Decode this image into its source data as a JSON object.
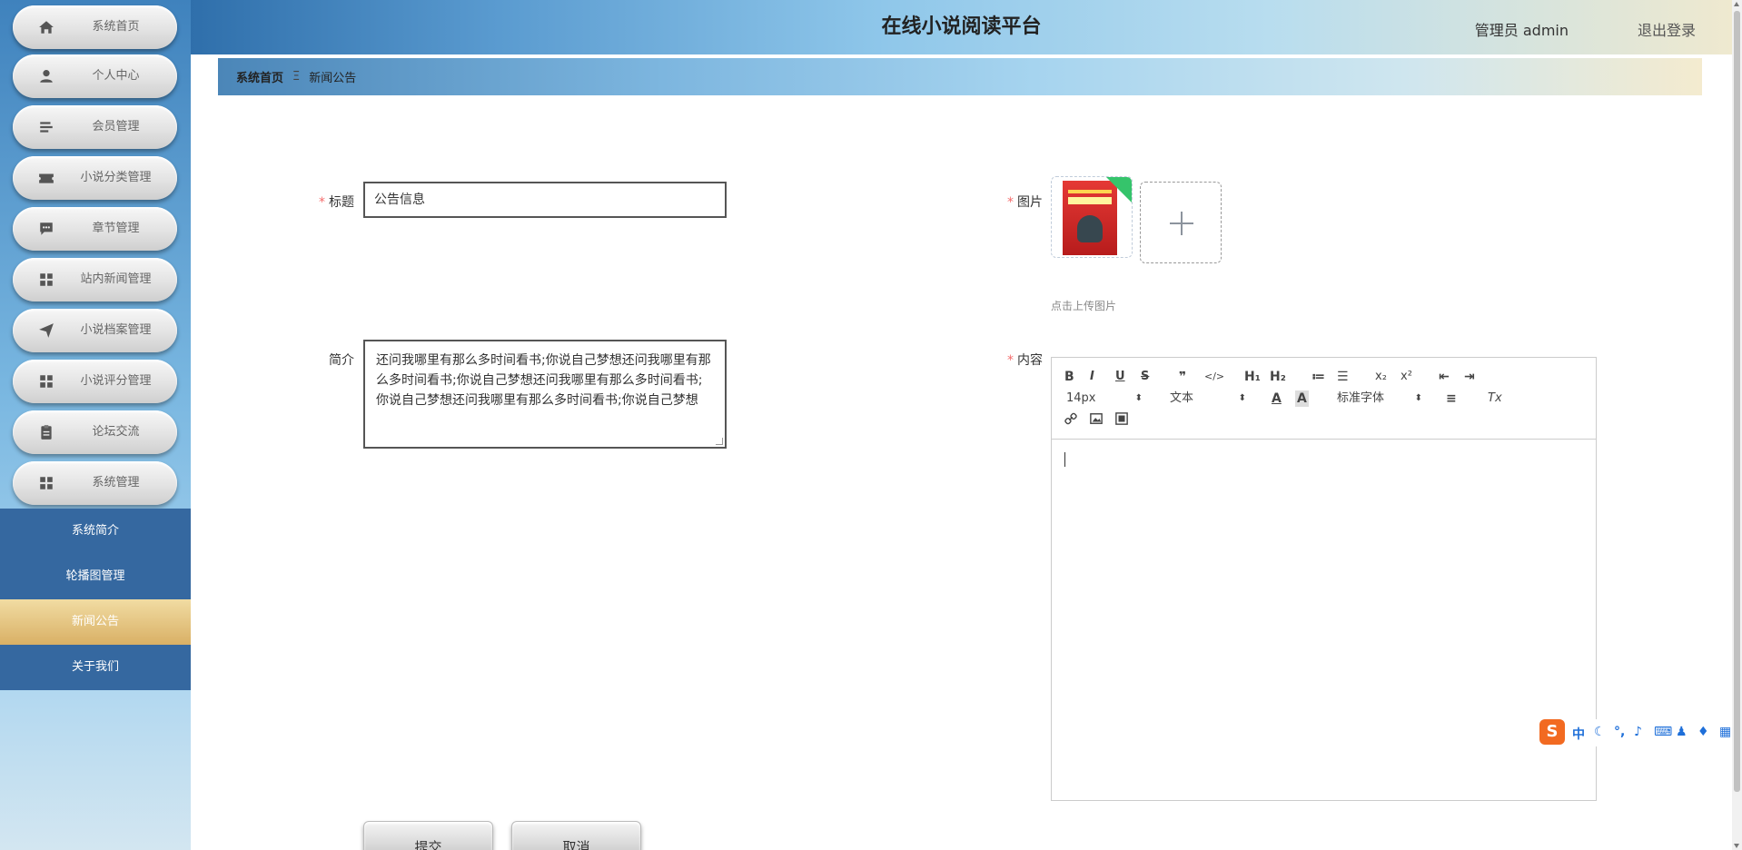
{
  "header": {
    "title": "在线小说阅读平台",
    "user": "管理员 admin",
    "logout": "退出登录"
  },
  "sidebar": {
    "items": [
      {
        "label": "系统首页",
        "icon": "home-icon"
      },
      {
        "label": "个人中心",
        "icon": "user-icon"
      },
      {
        "label": "会员管理",
        "icon": "list-icon"
      },
      {
        "label": "小说分类管理",
        "icon": "ticket-icon"
      },
      {
        "label": "章节管理",
        "icon": "chat-icon"
      },
      {
        "label": "站内新闻管理",
        "icon": "grid-icon"
      },
      {
        "label": "小说档案管理",
        "icon": "send-icon"
      },
      {
        "label": "小说评分管理",
        "icon": "grid-icon"
      },
      {
        "label": "论坛交流",
        "icon": "clipboard-icon"
      },
      {
        "label": "系统管理",
        "icon": "grid-icon"
      }
    ],
    "sub_items": [
      {
        "label": "系统简介"
      },
      {
        "label": "轮播图管理"
      },
      {
        "label": "新闻公告",
        "active": true
      },
      {
        "label": "关于我们"
      }
    ]
  },
  "breadcrumb": {
    "home": "系统首页",
    "separator": "Ξ",
    "current": "新闻公告"
  },
  "form": {
    "title_label": "标题",
    "title_value": "公告信息",
    "intro_label": "简介",
    "intro_value": "还问我哪里有那么多时间看书;你说自己梦想还问我哪里有那么多时间看书;你说自己梦想还问我哪里有那么多时间看书;你说自己梦想还问我哪里有那么多时间看书;你说自己梦想",
    "image_label": "图片",
    "image_hint": "点击上传图片",
    "content_label": "内容",
    "required_mark": "*"
  },
  "editor": {
    "font_size": "14px",
    "paragraph": "文本",
    "font_family": "标准字体",
    "buttons": {
      "bold": "B",
      "italic": "I",
      "underline": "U",
      "strike": "S",
      "quote": "❞",
      "code": "</>",
      "h1": "H₁",
      "h2": "H₂",
      "ol": "≔",
      "ul": "☰",
      "sub": "x₂",
      "sup": "x²",
      "outdent": "⇤",
      "indent": "⇥",
      "color": "A",
      "bg": "A",
      "align": "≡",
      "clean": "Tx",
      "link": "🔗",
      "image": "▣",
      "video": "▦"
    }
  },
  "actions": {
    "submit": "提交",
    "cancel": "取消"
  },
  "ime": {
    "logo": "S",
    "lang": "中"
  },
  "colors": {
    "required": "#f56c6c",
    "active_menu": "#d9b065",
    "sub_menu_bg": "#3568a0"
  }
}
